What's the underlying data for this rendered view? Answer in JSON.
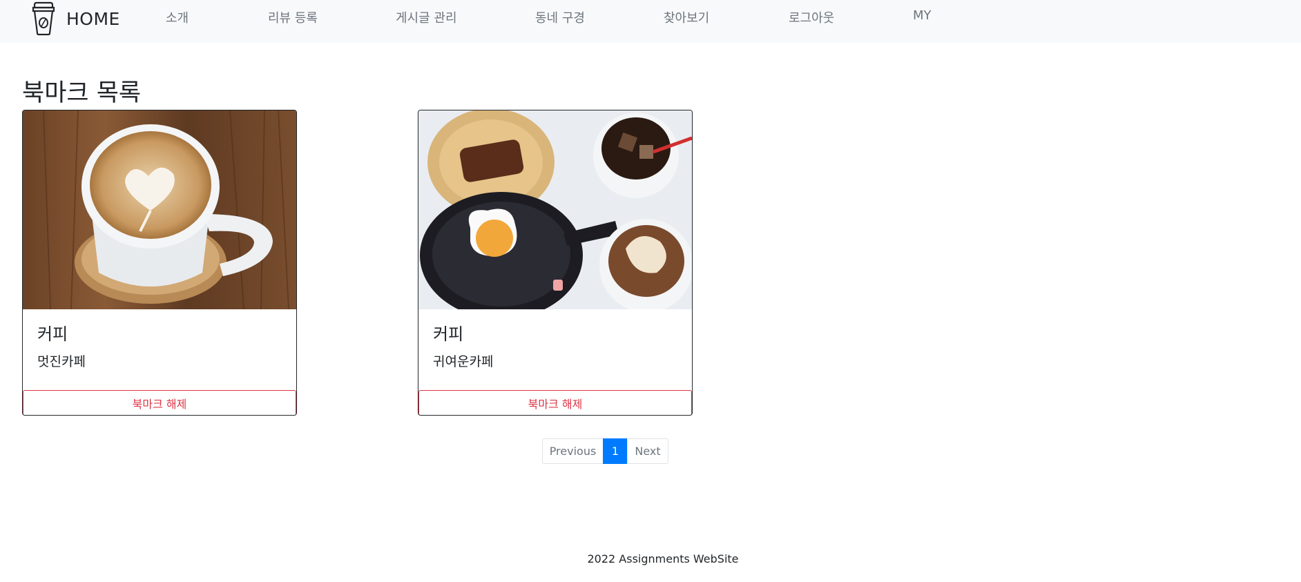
{
  "navbar": {
    "brand_label": "HOME",
    "brand_icon": "coffee-cup-icon",
    "links": [
      "소개",
      "리뷰 등록",
      "게시글 관리",
      "동네 구경",
      "찾아보기",
      "로그아웃",
      "MY"
    ]
  },
  "page": {
    "title": "북마크 목록"
  },
  "cards": [
    {
      "title": "커피",
      "name": "멋진카페",
      "button_label": "북마크 해제",
      "image": "latte-art-photo"
    },
    {
      "title": "커피",
      "name": "귀여운카페",
      "button_label": "북마크 해제",
      "image": "cafe-food-photo"
    }
  ],
  "pagination": {
    "previous_label": "Previous",
    "current_page": "1",
    "next_label": "Next"
  },
  "footer": {
    "text": "2022 Assignments WebSite"
  },
  "colors": {
    "navbar_bg": "#f8f9fa",
    "danger": "#dc3545",
    "primary": "#007bff",
    "muted": "#6c757d"
  }
}
